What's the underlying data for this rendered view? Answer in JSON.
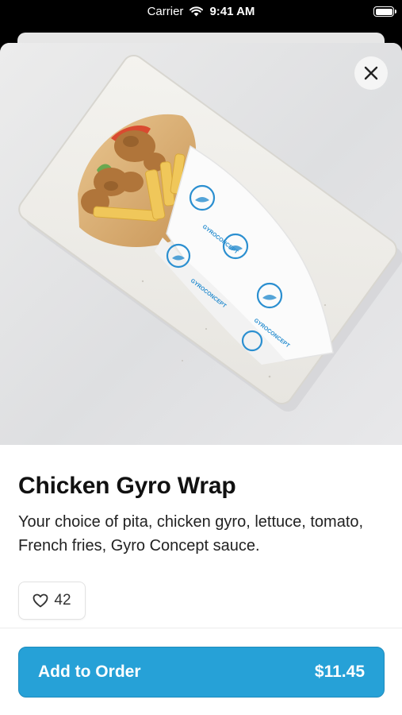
{
  "status_bar": {
    "carrier": "Carrier",
    "time": "9:41 AM"
  },
  "item": {
    "title": "Chicken Gyro Wrap",
    "description": "Your choice of pita, chicken gyro, lettuce, tomato, French fries, Gyro Concept sauce.",
    "likes": "42",
    "image_wrapper_text": "GYROCONCEPT"
  },
  "order_button": {
    "label": "Add to Order",
    "price": "$11.45"
  },
  "colors": {
    "accent": "#26a1d7",
    "wrap_print": "#2b8fd0"
  },
  "icons": [
    "wifi-icon",
    "battery-icon",
    "close-icon",
    "heart-icon"
  ]
}
